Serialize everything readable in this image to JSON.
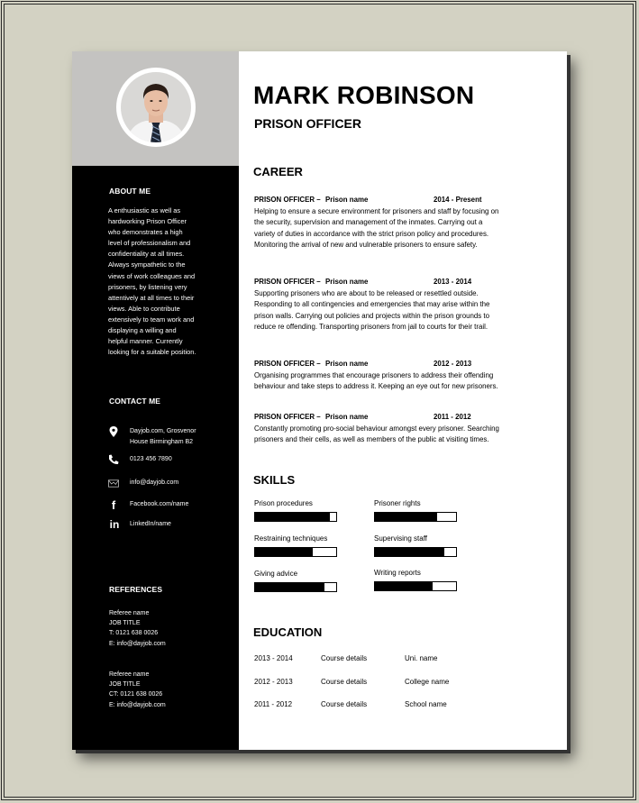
{
  "resume": {
    "name": "MARK ROBINSON",
    "job_title": "PRISON OFFICER",
    "about": {
      "heading": "ABOUT ME",
      "lines": [
        "A enthusiastic as well as",
        "hardworking Prison Officer",
        "who demonstrates a high",
        "level of professionalism and",
        "confidentiality at all times.",
        "Always sympathetic to the",
        "views of work colleagues and",
        "prisoners, by listening very",
        "attentively at all times to their",
        "views. Able to contribute",
        "extensively to team work and",
        "displaying a willing and",
        "helpful manner. Currently",
        "looking for a suitable position."
      ]
    },
    "contact": {
      "heading": "CONTACT ME",
      "items": [
        {
          "icon": "location-pin-icon",
          "lines": [
            "Dayjob.com, Grosvenor",
            "House Birmingham B2"
          ]
        },
        {
          "icon": "phone-icon",
          "lines": [
            "0123 456 7890"
          ]
        },
        {
          "icon": "envelope-icon",
          "lines": [
            "info@dayjob.com"
          ]
        },
        {
          "icon": "facebook-icon",
          "lines": [
            "Facebook.com/name"
          ]
        },
        {
          "icon": "linkedin-icon",
          "lines": [
            "LinkedIn/name"
          ]
        }
      ]
    },
    "references": {
      "heading": "REFERENCES",
      "items": [
        {
          "name": "Referee name",
          "title": "JOB TITLE",
          "phone": "T: 0121 638 0026",
          "email": "E: info@dayjob.com"
        },
        {
          "name": "Referee name",
          "title": "JOB TITLE",
          "phone": "CT: 0121 638 0026",
          "email": "E: info@dayjob.com"
        }
      ]
    },
    "career": {
      "heading": "CAREER",
      "jobs": [
        {
          "role": "PRISON OFFICER –",
          "org": "Prison name",
          "dates": "2014 - Present",
          "lines": [
            "Helping to ensure a secure environment for prisoners and staff by focusing on",
            "the security, supervision and management of the inmates. Carrying out a",
            "variety of duties in accordance with the strict prison policy and procedures.",
            "Monitoring the arrival of new and vulnerable prisoners to ensure safety."
          ]
        },
        {
          "role": "PRISON OFFICER –",
          "org": "Prison name",
          "dates": "2013 - 2014",
          "lines": [
            "Supporting prisoners who are about to be released or resettled outside.",
            "Responding to all contingencies and emergencies that may arise within the",
            "prison walls. Carrying out policies and projects within the prison grounds to",
            "reduce re offending. Transporting prisoners from jail to courts for their trail."
          ]
        },
        {
          "role": "PRISON OFFICER –",
          "org": "Prison name",
          "dates": "2012 - 2013",
          "lines": [
            "Organising programmes that encourage prisoners to address their offending",
            "behaviour and take steps to address it. Keeping an eye out for new prisoners."
          ]
        },
        {
          "role": "PRISON OFFICER –",
          "org": "Prison name",
          "dates": "2011 - 2012",
          "lines": [
            "Constantly promoting pro-social behaviour amongst every prisoner. Searching",
            "prisoners and their cells, as well as members of the public at visiting times."
          ]
        }
      ]
    },
    "skills": {
      "heading": "SKILLS",
      "items": [
        {
          "label": "Prison procedures",
          "level": 0.92
        },
        {
          "label": "Prisoner rights",
          "level": 0.77
        },
        {
          "label": "Restraining techniques",
          "level": 0.71
        },
        {
          "label": "Supervising staff",
          "level": 0.86
        },
        {
          "label": "Giving advice",
          "level": 0.86
        },
        {
          "label": "Writing reports",
          "level": 0.71
        }
      ]
    },
    "education": {
      "heading": "EDUCATION",
      "rows": [
        {
          "years": "2013 - 2014",
          "course": "Course details",
          "school": "Uni. name"
        },
        {
          "years": "2012 - 2013",
          "course": "Course details",
          "school": "College name"
        },
        {
          "years": "2011 - 2012",
          "course": "Course details",
          "school": "School name"
        }
      ]
    }
  },
  "colors": {
    "background": "#d3d2c3",
    "sidebar": "#000000",
    "photo_band": "#c4c3c1",
    "page": "#ffffff",
    "text": "#000000"
  }
}
